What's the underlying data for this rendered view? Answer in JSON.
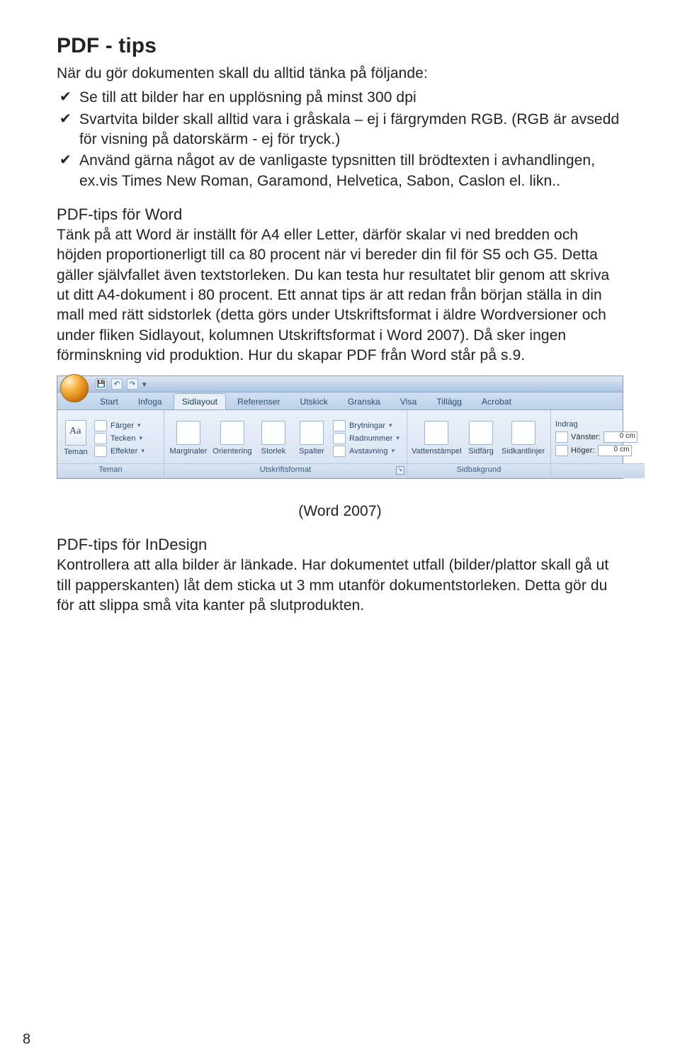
{
  "title": "PDF - tips",
  "intro": "När du gör dokumenten skall du alltid tänka på följande:",
  "bullets": [
    "Se till att bilder har en upplösning på minst 300 dpi",
    "Svartvita bilder skall alltid vara i gråskala – ej i färgrymden RGB. (RGB är avsedd för visning på datorskärm - ej för tryck.)",
    "Använd gärna något av de vanligaste typsnitten till brödtexten i avhandlingen, ex.vis Times New Roman, Garamond, Helvetica, Sabon, Caslon el. likn.."
  ],
  "word_heading": "PDF-tips för Word",
  "word_body": "Tänk på att Word är inställt för A4 eller Letter, därför skalar vi ned bredden och höjden proportionerligt till ca 80 procent när vi bereder din fil för S5 och G5. Detta gäller självfallet även textstorleken. Du kan testa hur resultatet blir genom att skriva ut ditt A4-dokument i 80 procent. Ett annat tips är att redan från början ställa in din mall med rätt sidstorlek (detta görs under Utskriftsformat i äldre Wordversioner och under fliken Sidlayout, kolumnen Utskriftsformat i Word 2007). Då sker ingen förminskning vid produktion. Hur du skapar PDF från Word står på s.9.",
  "caption": "(Word 2007)",
  "indesign_heading": "PDF-tips för InDesign",
  "indesign_body": "Kontrollera att alla bilder är länkade. Har dokumentet utfall (bilder/plattor skall gå ut till papperskanten) låt dem sticka ut 3 mm utanför dokumentstorleken. Detta gör du för att slippa små vita kanter på slutprodukten.",
  "page_number": "8",
  "ribbon": {
    "tabs": [
      "Start",
      "Infoga",
      "Sidlayout",
      "Referenser",
      "Utskick",
      "Granska",
      "Visa",
      "Tillägg",
      "Acrobat"
    ],
    "active_tab": 2,
    "groups": {
      "teman": {
        "label": "Teman",
        "big": "Teman",
        "rows": [
          "Färger",
          "Tecken",
          "Effekter"
        ]
      },
      "utskrift": {
        "label": "Utskriftsformat",
        "big": [
          "Marginaler",
          "Orientering",
          "Storlek",
          "Spalter"
        ],
        "rows": [
          "Brytningar",
          "Radnummer",
          "Avstavning"
        ]
      },
      "sidbakgrund": {
        "label": "Sidbakgrund",
        "big": [
          "Vattenstämpel",
          "Sidfärg",
          "Sidkantlinjer"
        ]
      },
      "indrag": {
        "title": "Indrag",
        "left_label": "Vänster:",
        "right_label": "Höger:",
        "left_value": "0 cm",
        "right_value": "0 cm"
      }
    }
  }
}
